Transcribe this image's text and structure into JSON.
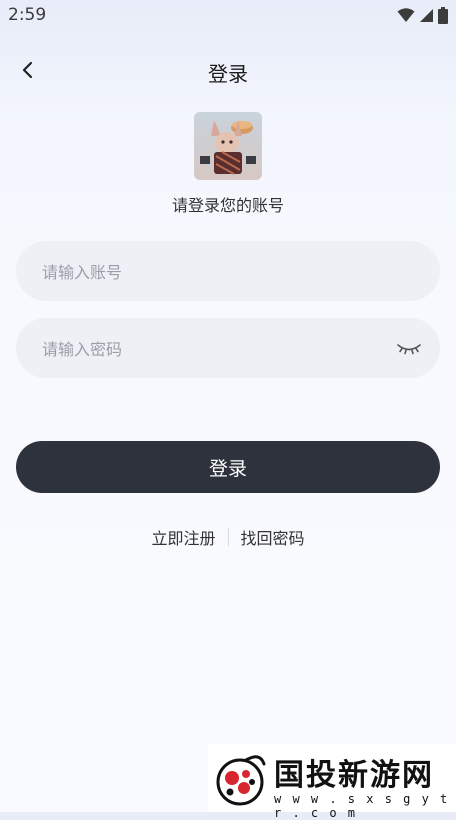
{
  "status_bar": {
    "time": "2:59"
  },
  "nav": {
    "title": "登录"
  },
  "header": {
    "subtitle": "请登录您的账号"
  },
  "form": {
    "account_placeholder": "请输入账号",
    "password_placeholder": "请输入密码",
    "login_label": "登录"
  },
  "links": {
    "register": "立即注册",
    "recover": "找回密码"
  },
  "watermark": {
    "title": "国投新游网",
    "url": "w w w . s x s g y t r . c o m"
  },
  "icons": {
    "back": "chevron-left-icon",
    "eye": "eye-closed-icon",
    "wifi": "wifi-icon",
    "signal": "signal-icon",
    "battery": "battery-icon"
  },
  "colors": {
    "primary_button": "#2e323c",
    "input_bg": "#eef0f6",
    "watermark_red": "#d8262f"
  }
}
